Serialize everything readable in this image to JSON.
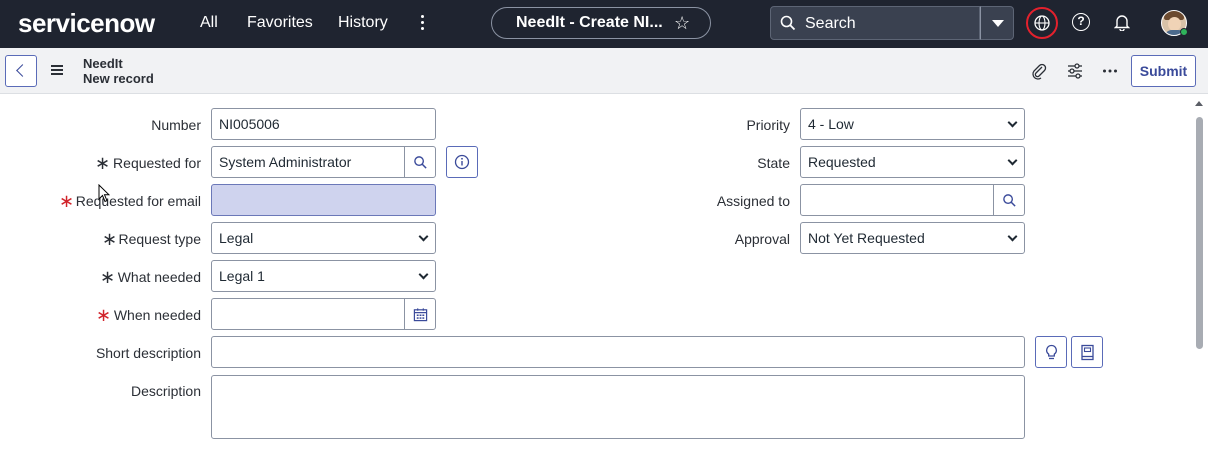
{
  "topbar": {
    "logo": "servicenow",
    "nav": [
      "All",
      "Favorites",
      "History"
    ],
    "context_title": "NeedIt - Create NI...",
    "search_label": "Search"
  },
  "form_header": {
    "table": "NeedIt",
    "subtitle": "New record",
    "submit_label": "Submit"
  },
  "form": {
    "number": {
      "label": "Number",
      "value": "NI005006"
    },
    "requested_for": {
      "label": "Requested for",
      "value": "System Administrator"
    },
    "requested_for_email": {
      "label": "Requested for email",
      "value": ""
    },
    "request_type": {
      "label": "Request type",
      "value": "Legal"
    },
    "what_needed": {
      "label": "What needed",
      "value": "Legal 1"
    },
    "when_needed": {
      "label": "When needed",
      "value": ""
    },
    "short_description": {
      "label": "Short description",
      "value": ""
    },
    "description": {
      "label": "Description",
      "value": ""
    },
    "priority": {
      "label": "Priority",
      "value": "4 - Low"
    },
    "state": {
      "label": "State",
      "value": "Requested"
    },
    "assigned_to": {
      "label": "Assigned to",
      "value": ""
    },
    "approval": {
      "label": "Approval",
      "value": "Not Yet Requested"
    }
  },
  "colors": {
    "topbar_bg": "#1f2430",
    "accent": "#3a4a9a",
    "required_red": "#d1232a",
    "highlight_field": "#cfd3ee"
  }
}
